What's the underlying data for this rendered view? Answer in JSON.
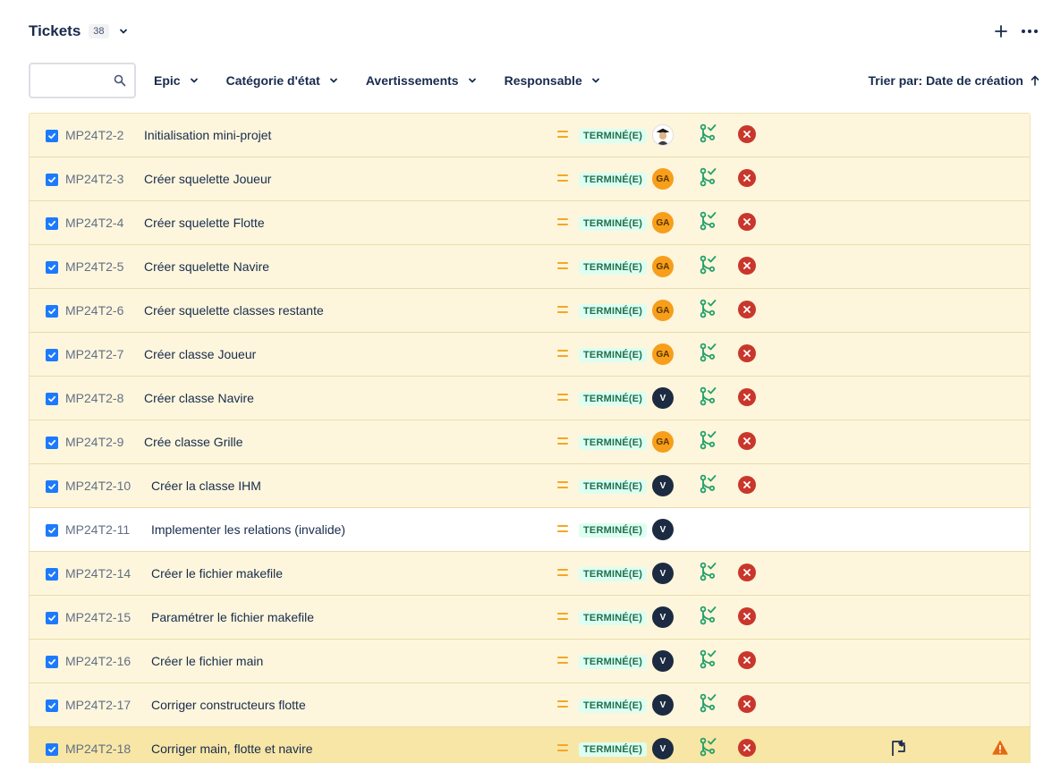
{
  "header": {
    "title": "Tickets",
    "count": "38",
    "icons": [
      "chevron-down-icon",
      "plus-icon",
      "more-icon"
    ]
  },
  "filters": {
    "search_placeholder": "",
    "epic": "Epic",
    "category": "Catégorie d'état",
    "warnings": "Avertissements",
    "assignee": "Responsable",
    "sort": "Trier par: Date de création"
  },
  "colors": {
    "row_bg": "#fdf6dc",
    "row_selected_bg": "#f8e6a6",
    "status_bg": "#dcfff1",
    "status_text": "#216e4e",
    "priority": "#f5a623",
    "cancel": "#c9372c",
    "merge": "#22a06b",
    "warning": "#e56910"
  },
  "rows": [
    {
      "key": "MP24T2-2",
      "summary": "Initialisation mini-projet",
      "status": "TERMINÉ(E)",
      "assignee": ""
    },
    {
      "key": "MP24T2-3",
      "summary": "Créer squelette Joueur",
      "status": "TERMINÉ(E)",
      "assignee": "GA"
    },
    {
      "key": "MP24T2-4",
      "summary": "Créer squelette Flotte",
      "status": "TERMINÉ(E)",
      "assignee": "GA"
    },
    {
      "key": "MP24T2-5",
      "summary": "Créer squelette Navire",
      "status": "TERMINÉ(E)",
      "assignee": "GA"
    },
    {
      "key": "MP24T2-6",
      "summary": "Créer squelette classes restante",
      "status": "TERMINÉ(E)",
      "assignee": "GA"
    },
    {
      "key": "MP24T2-7",
      "summary": "Créer classe Joueur",
      "status": "TERMINÉ(E)",
      "assignee": "GA"
    },
    {
      "key": "MP24T2-8",
      "summary": "Créer classe Navire",
      "status": "TERMINÉ(E)",
      "assignee": "V"
    },
    {
      "key": "MP24T2-9",
      "summary": "Crée classe Grille",
      "status": "TERMINÉ(E)",
      "assignee": "GA"
    },
    {
      "key": "MP24T2-10",
      "summary": "Créer la classe IHM",
      "status": "TERMINÉ(E)",
      "assignee": "V"
    },
    {
      "key": "MP24T2-11",
      "summary": "Implementer les relations (invalide)",
      "status": "TERMINÉ(E)",
      "assignee": "V"
    },
    {
      "key": "MP24T2-14",
      "summary": "Créer le fichier makefile",
      "status": "TERMINÉ(E)",
      "assignee": "V"
    },
    {
      "key": "MP24T2-15",
      "summary": "Paramétrer le fichier makefile",
      "status": "TERMINÉ(E)",
      "assignee": "V"
    },
    {
      "key": "MP24T2-16",
      "summary": "Créer le fichier main",
      "status": "TERMINÉ(E)",
      "assignee": "V"
    },
    {
      "key": "MP24T2-17",
      "summary": "Corriger constructeurs flotte",
      "status": "TERMINÉ(E)",
      "assignee": "V"
    },
    {
      "key": "MP24T2-18",
      "summary": "Corriger main, flotte et navire",
      "status": "TERMINÉ(E)",
      "assignee": "V"
    }
  ]
}
